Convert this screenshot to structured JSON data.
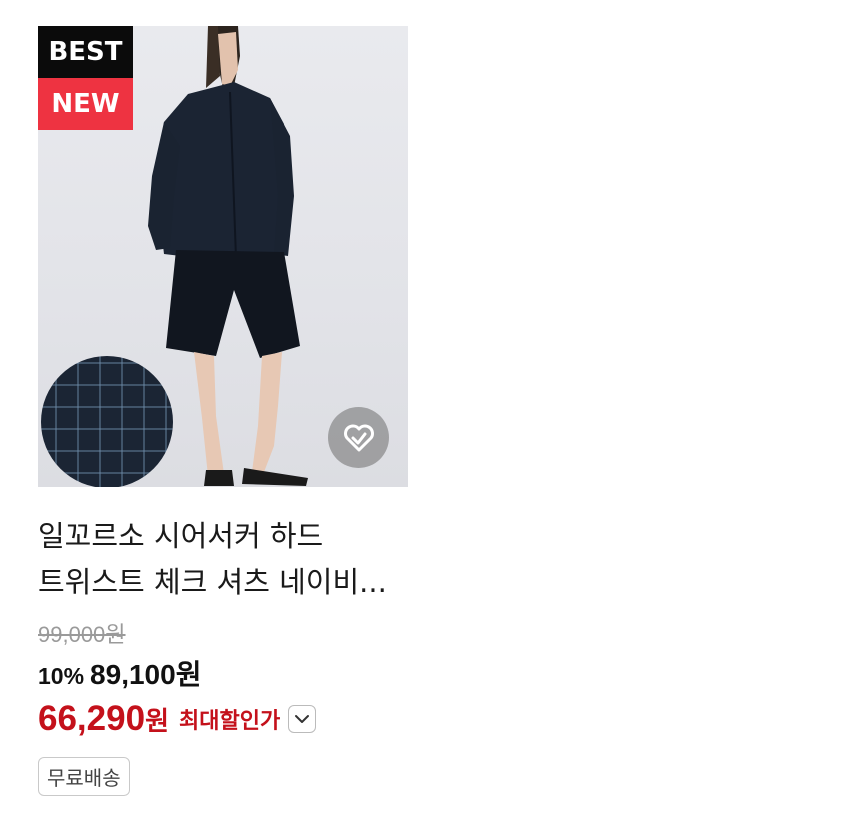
{
  "product": {
    "badges": {
      "best": "BEST",
      "new": "NEW"
    },
    "title": "일꼬르소 시어서커 하드 트위스트 체크 셔츠 네이비...",
    "original_price": "99,000원",
    "discount_rate": "10%",
    "sale_price": "89,100원",
    "max_discount_price": "66,290",
    "max_discount_won": "원",
    "max_discount_label": "최대할인가",
    "shipping_tag": "무료배송"
  },
  "colors": {
    "best_badge": "#0b0b0b",
    "new_badge": "#ee3341",
    "max_price": "#c4111b",
    "image_bg": "#e6e7eb"
  },
  "icons": {
    "wishlist": "heart-check-icon",
    "expand": "chevron-down-icon"
  }
}
